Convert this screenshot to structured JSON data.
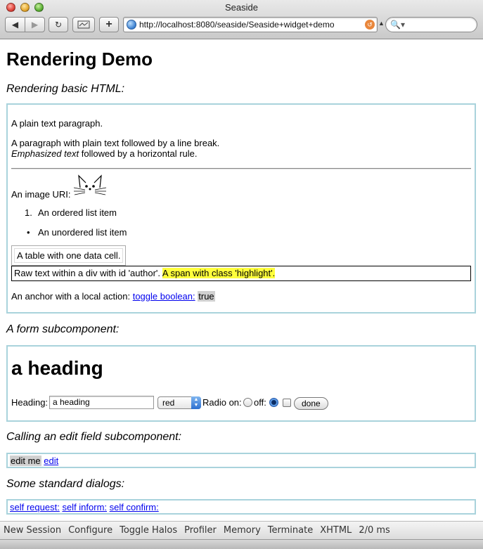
{
  "window": {
    "title": "Seaside"
  },
  "toolbar_buttons": {
    "back_icon": "back-arrow-icon",
    "forward_icon": "forward-arrow-icon",
    "reload_icon": "reload-icon",
    "snapback_icon": "snapback-icon",
    "add_icon": "plus-icon"
  },
  "address_bar": {
    "url": "http://localhost:8080/seaside/Seaside+widget+demo"
  },
  "search": {
    "placeholder": ""
  },
  "page": {
    "title": "Rendering Demo",
    "sections": {
      "basic_html": "Rendering basic HTML:",
      "form": "A form subcomponent:",
      "edit_field": "Calling an edit field subcomponent:",
      "dialogs": "Some standard dialogs:"
    },
    "basic": {
      "plain_paragraph": "A plain text paragraph.",
      "line_break_paragraph": "A paragraph with plain text followed by a line break.",
      "emphasized": "Emphasized text",
      "after_emphasized": " followed by a horizontal rule.",
      "image_label": "An image URI:",
      "ordered_item": "An ordered list item",
      "ordered_number": "1.",
      "unordered_item": "An unordered list item",
      "table_cell": "A table with one data cell.",
      "raw_text": "Raw text within a div with id 'author'. ",
      "highlight_span": "A span with class 'highlight'.",
      "anchor_label": "An anchor with a local action: ",
      "anchor_link": "toggle boolean:",
      "anchor_value": "true"
    },
    "form": {
      "heading": "a heading",
      "heading_label": "Heading:",
      "heading_value": "a heading",
      "color_select": "red",
      "radio_on_label": "Radio on:",
      "radio_off_label": "off:",
      "radio_state": "off",
      "checkbox_checked": false,
      "done_button": "done"
    },
    "edit_field": {
      "value": "edit me",
      "link": "edit"
    },
    "dialogs": {
      "request": "self request:",
      "inform": "self inform:",
      "confirm": "self confirm:"
    }
  },
  "halo_toolbar": {
    "new_session": "New Session",
    "configure": "Configure",
    "toggle_halos": "Toggle Halos",
    "profiler": "Profiler",
    "memory": "Memory",
    "terminate": "Terminate",
    "xhtml": "XHTML",
    "timing": "2/0 ms"
  }
}
